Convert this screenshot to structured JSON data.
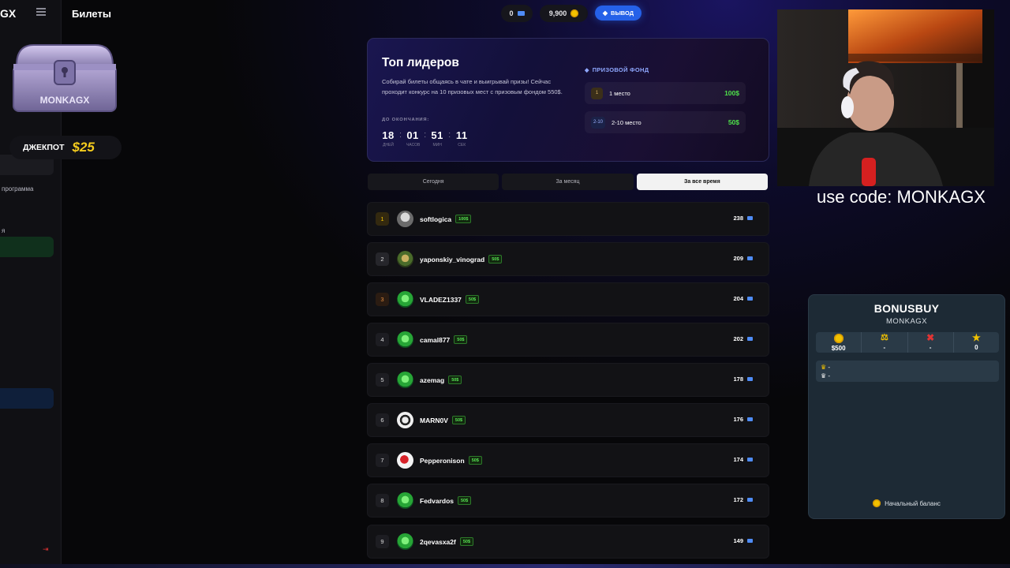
{
  "sidebar": {
    "logo_partial": "GX",
    "item_program_partial": "программа",
    "item_ya_partial": "я",
    "colors": {
      "active_green": "#10301c",
      "active_blue": "#0f1f3a"
    }
  },
  "header": {
    "title": "Билеты",
    "tickets": "0",
    "balance": "9,900",
    "withdraw_label": "ВЫВОД"
  },
  "chest_text": "MONKAGX",
  "jackpot": {
    "label": "ДЖЕКПОТ",
    "value": "$25"
  },
  "hero": {
    "title": "Топ лидеров",
    "description": "Собирай билеты общаясь в чате и выигрывай призы! Сейчас проходит конкурс на 10 призовых мест с призовым фондом 550$.",
    "until_label": "ДО ОКОНЧАНИЯ:",
    "timer": [
      {
        "value": "18",
        "unit": "ДНЕЙ"
      },
      {
        "value": "01",
        "unit": "ЧАСОВ"
      },
      {
        "value": "51",
        "unit": "МИН"
      },
      {
        "value": "11",
        "unit": "СЕК"
      }
    ],
    "prize_fund_label": "ПРИЗОВОЙ ФОНД",
    "prizes": [
      {
        "rank": "1",
        "place": "1 место",
        "amount": "100$"
      },
      {
        "rank": "2-10",
        "place": "2-10 место",
        "amount": "50$"
      }
    ]
  },
  "tabs": [
    {
      "label": "Сегодня",
      "active": false
    },
    {
      "label": "За месяц",
      "active": false
    },
    {
      "label": "За все время",
      "active": true
    }
  ],
  "leaderboard": [
    {
      "rank": "1",
      "name": "softlogica",
      "prize": "100$",
      "score": "238"
    },
    {
      "rank": "2",
      "name": "yaponskiy_vinograd",
      "prize": "50$",
      "score": "209"
    },
    {
      "rank": "3",
      "name": "VLADEZ1337",
      "prize": "50$",
      "score": "204"
    },
    {
      "rank": "4",
      "name": "camal877",
      "prize": "50$",
      "score": "202"
    },
    {
      "rank": "5",
      "name": "azemag",
      "prize": "50$",
      "score": "178"
    },
    {
      "rank": "6",
      "name": "MARN0V",
      "prize": "50$",
      "score": "176"
    },
    {
      "rank": "7",
      "name": "Pepperonison",
      "prize": "50$",
      "score": "174"
    },
    {
      "rank": "8",
      "name": "Fedvardos",
      "prize": "50$",
      "score": "172"
    },
    {
      "rank": "9",
      "name": "2qevasxa2f",
      "prize": "50$",
      "score": "149"
    }
  ],
  "overlay": {
    "promo": "use code: MONKAGX",
    "bonusbuy": {
      "title": "BONUSBUY",
      "subtitle": "MONKAGX",
      "stats": [
        "$500",
        "-",
        "-",
        "0"
      ],
      "list": [
        "-",
        "-"
      ],
      "footer": "Начальный баланс"
    }
  }
}
